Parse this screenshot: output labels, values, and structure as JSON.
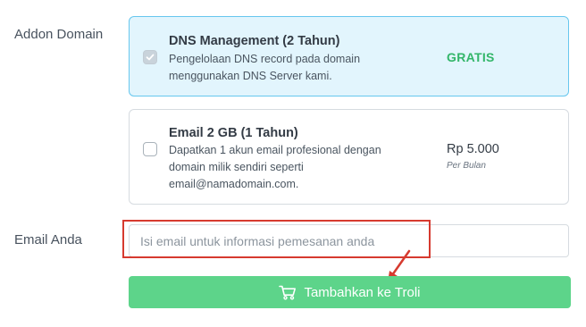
{
  "form": {
    "addon_label": "Addon Domain",
    "email_label": "Email Anda"
  },
  "addons": [
    {
      "title": "DNS Management (2 Tahun)",
      "description": "Pengelolaan DNS record pada domain menggunakan DNS Server kami.",
      "price": "GRATIS",
      "checked": true,
      "price_color": "#33b66a"
    },
    {
      "title": "Email 2 GB (1 Tahun)",
      "description": "Dapatkan 1 akun email profesional dengan domain milik sendiri seperti email@namadomain.com.",
      "price": "Rp 5.000",
      "period": "Per Bulan",
      "checked": false
    }
  ],
  "email_input": {
    "value": "",
    "placeholder": "Isi email untuk informasi pemesanan anda"
  },
  "cart_button": {
    "label": "Tambahkan ke Troli",
    "icon": "cart-icon",
    "color": "#5dd48a"
  },
  "annotation": {
    "color": "#d63a2f"
  },
  "theme": {
    "selected_card_bg": "#e2f5fd",
    "selected_card_border": "#67c7ee"
  }
}
